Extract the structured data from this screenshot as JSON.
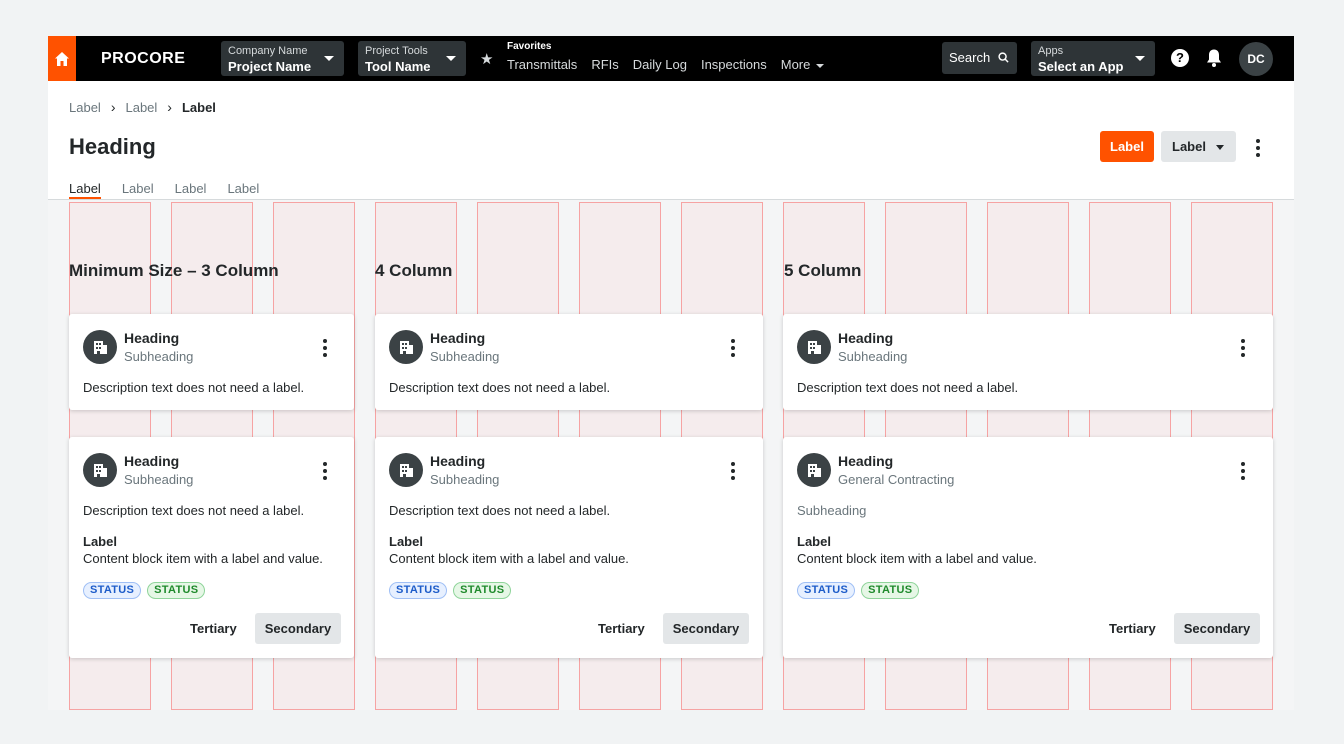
{
  "nav": {
    "brand": "PROCORE",
    "company": {
      "label": "Company Name",
      "value": "Project Name"
    },
    "project_tools": {
      "label": "Project Tools",
      "value": "Tool Name"
    },
    "favorites": {
      "label": "Favorites",
      "links": [
        "Transmittals",
        "RFIs",
        "Daily Log",
        "Inspections",
        "More"
      ]
    },
    "search_label": "Search",
    "apps": {
      "label": "Apps",
      "value": "Select an App"
    },
    "help_glyph": "?",
    "avatar_initials": "DC",
    "icons": [
      "home-icon",
      "star-icon",
      "search-icon",
      "help-icon",
      "bell-icon"
    ],
    "colors": {
      "bar": "#000000",
      "accent": "#ff5200"
    }
  },
  "header": {
    "breadcrumbs": [
      "Label",
      "Label",
      "Label"
    ],
    "title": "Heading",
    "primary_button": "Label",
    "dropdown_button": "Label",
    "tabs": [
      "Label",
      "Label",
      "Label",
      "Label"
    ]
  },
  "sections": [
    {
      "title": "Minimum Size – 3 Column"
    },
    {
      "title": "4 Column"
    },
    {
      "title": "5 Column"
    }
  ],
  "cards": {
    "simple": [
      {
        "heading": "Heading",
        "subheading": "Subheading",
        "description": "Description text does not need a label."
      },
      {
        "heading": "Heading",
        "subheading": "Subheading",
        "description": "Description text does not need a label."
      },
      {
        "heading": "Heading",
        "subheading": "Subheading",
        "description": "Description text does not need a label."
      }
    ],
    "detailed": [
      {
        "heading": "Heading",
        "subheading": "Subheading",
        "description": "Description text does not need a label.",
        "item_label": "Label",
        "item_value": "Content block item with a label and value.",
        "statuses": [
          "STATUS",
          "STATUS"
        ],
        "tertiary": "Tertiary",
        "secondary": "Secondary"
      },
      {
        "heading": "Heading",
        "subheading": "Subheading",
        "description": "Description text does not need a label.",
        "item_label": "Label",
        "item_value": "Content block item with a label and value.",
        "statuses": [
          "STATUS",
          "STATUS"
        ],
        "tertiary": "Tertiary",
        "secondary": "Secondary"
      },
      {
        "heading": "Heading",
        "subheading": "General Contracting",
        "description": "Subheading",
        "item_label": "Label",
        "item_value": "Content block item with a label and value.",
        "statuses": [
          "STATUS",
          "STATUS"
        ],
        "tertiary": "Tertiary",
        "secondary": "Secondary"
      }
    ]
  }
}
